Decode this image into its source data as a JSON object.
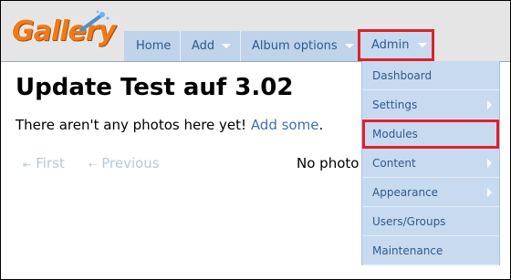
{
  "logo": {
    "text": "Gallery"
  },
  "nav": {
    "items": [
      {
        "label": "Home"
      },
      {
        "label": "Add"
      },
      {
        "label": "Album options"
      },
      {
        "label": "Admin"
      }
    ]
  },
  "admin_menu": {
    "items": [
      {
        "label": "Dashboard"
      },
      {
        "label": "Settings"
      },
      {
        "label": "Modules"
      },
      {
        "label": "Content"
      },
      {
        "label": "Appearance"
      },
      {
        "label": "Users/Groups"
      },
      {
        "label": "Maintenance"
      }
    ]
  },
  "page": {
    "title": "Update Test auf 3.02",
    "empty_text": "There aren't any photos here yet!",
    "add_link": "Add some",
    "period": ".",
    "no_photos_text": "No photo"
  },
  "pager": {
    "first": "First",
    "previous": "Previous"
  },
  "colors": {
    "accent": "#e0202a",
    "menu_bg": "#c8daf0",
    "link": "#3f71b0",
    "logo": "#f07a1a"
  }
}
